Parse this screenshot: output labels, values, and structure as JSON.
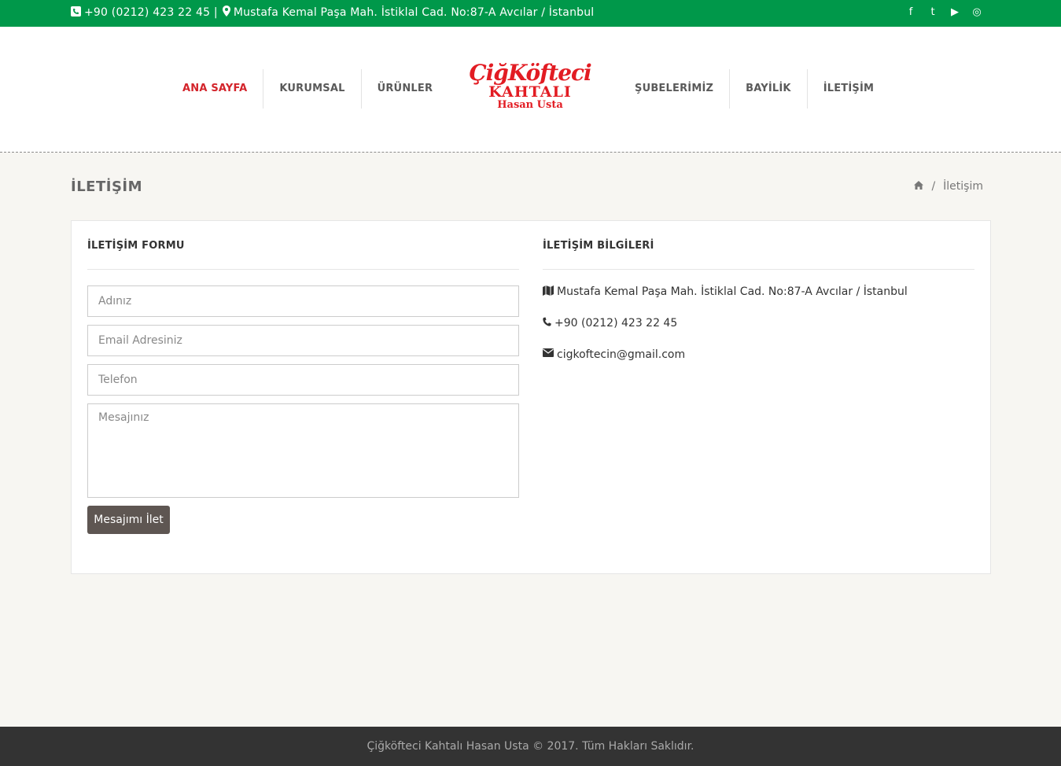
{
  "topbar": {
    "phone_icon": "phone-square-icon",
    "phone": "+90 (0212) 423 22 45 |",
    "location_icon": "map-marker-icon",
    "address": "Mustafa Kemal Paşa Mah. İstiklal Cad. No:87-A Avcılar / İstanbul",
    "social": [
      {
        "name": "facebook-icon",
        "glyph": "f"
      },
      {
        "name": "twitter-icon",
        "glyph": "t"
      },
      {
        "name": "youtube-icon",
        "glyph": "▶"
      },
      {
        "name": "instagram-icon",
        "glyph": "◎"
      }
    ]
  },
  "nav": {
    "left": [
      "ANA SAYFA",
      "KURUMSAL",
      "ÜRÜNLER"
    ],
    "right": [
      "ŞUBELERİMİZ",
      "BAYİLİK",
      "İLETİŞİM"
    ],
    "active": "ANA SAYFA"
  },
  "logo": {
    "line1": "ÇiğKöfteci",
    "line2": "KAHTALI",
    "line3": "Hasan Usta"
  },
  "page": {
    "title": "İLETİŞİM",
    "breadcrumb_sep": "/",
    "breadcrumb_current": "İletişim"
  },
  "form": {
    "heading": "İLETİŞİM FORMU",
    "name_placeholder": "Adınız",
    "email_placeholder": "Email Adresiniz",
    "phone_placeholder": "Telefon",
    "message_placeholder": "Mesajınız",
    "submit_label": "Mesajımı İlet"
  },
  "info": {
    "heading": "İLETİŞİM BİLGİLERİ",
    "address": "Mustafa Kemal Paşa Mah. İstiklal Cad. No:87-A Avcılar / İstanbul",
    "phone": "+90 (0212) 423 22 45",
    "email": "cigkoftecin@gmail.com"
  },
  "footer": {
    "text": "Çiğköfteci Kahtalı Hasan Usta © 2017. Tüm Hakları Saklıdır."
  },
  "colors": {
    "topbar": "#00984a",
    "accent": "#d3242b",
    "footer": "#333333",
    "button": "#5e5652"
  }
}
